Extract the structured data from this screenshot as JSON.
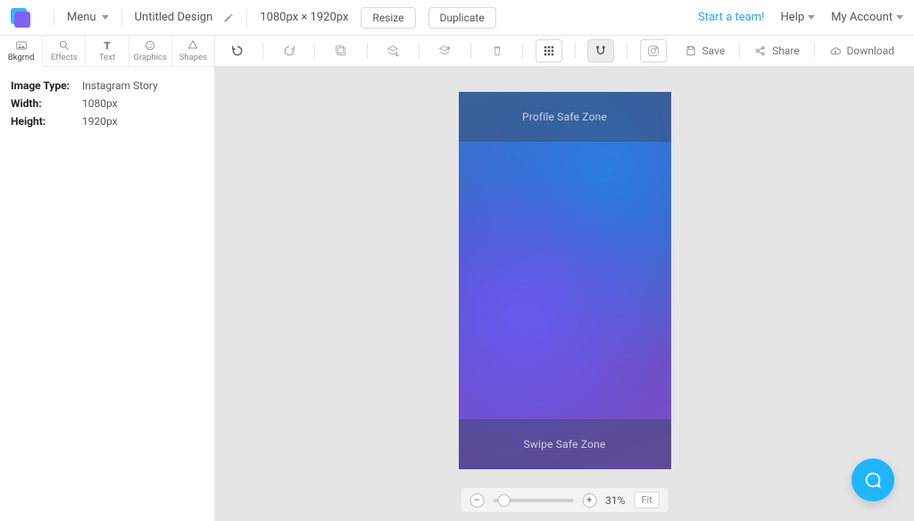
{
  "header": {
    "menu_label": "Menu",
    "design_name": "Untitled Design",
    "dimensions_text": "1080px × 1920px",
    "resize_label": "Resize",
    "duplicate_label": "Duplicate",
    "team_link": "Start a team!",
    "help_label": "Help",
    "account_label": "My Account"
  },
  "tooltabs": [
    {
      "key": "bkgrnd",
      "label": "Bkgrnd"
    },
    {
      "key": "effects",
      "label": "Effects"
    },
    {
      "key": "text",
      "label": "Text"
    },
    {
      "key": "graphics",
      "label": "Graphics"
    },
    {
      "key": "shapes",
      "label": "Shapes"
    }
  ],
  "properties": {
    "image_type_label": "Image Type:",
    "image_type_value": "Instagram Story",
    "width_label": "Width:",
    "width_value": "1080px",
    "height_label": "Height:",
    "height_value": "1920px"
  },
  "canvas_toolbar": {
    "save_label": "Save",
    "share_label": "Share",
    "download_label": "Download"
  },
  "artboard": {
    "top_safezone": "Profile Safe Zone",
    "bottom_safezone": "Swipe Safe Zone"
  },
  "zoom": {
    "level_text": "31%",
    "fit_label": "Fit"
  }
}
